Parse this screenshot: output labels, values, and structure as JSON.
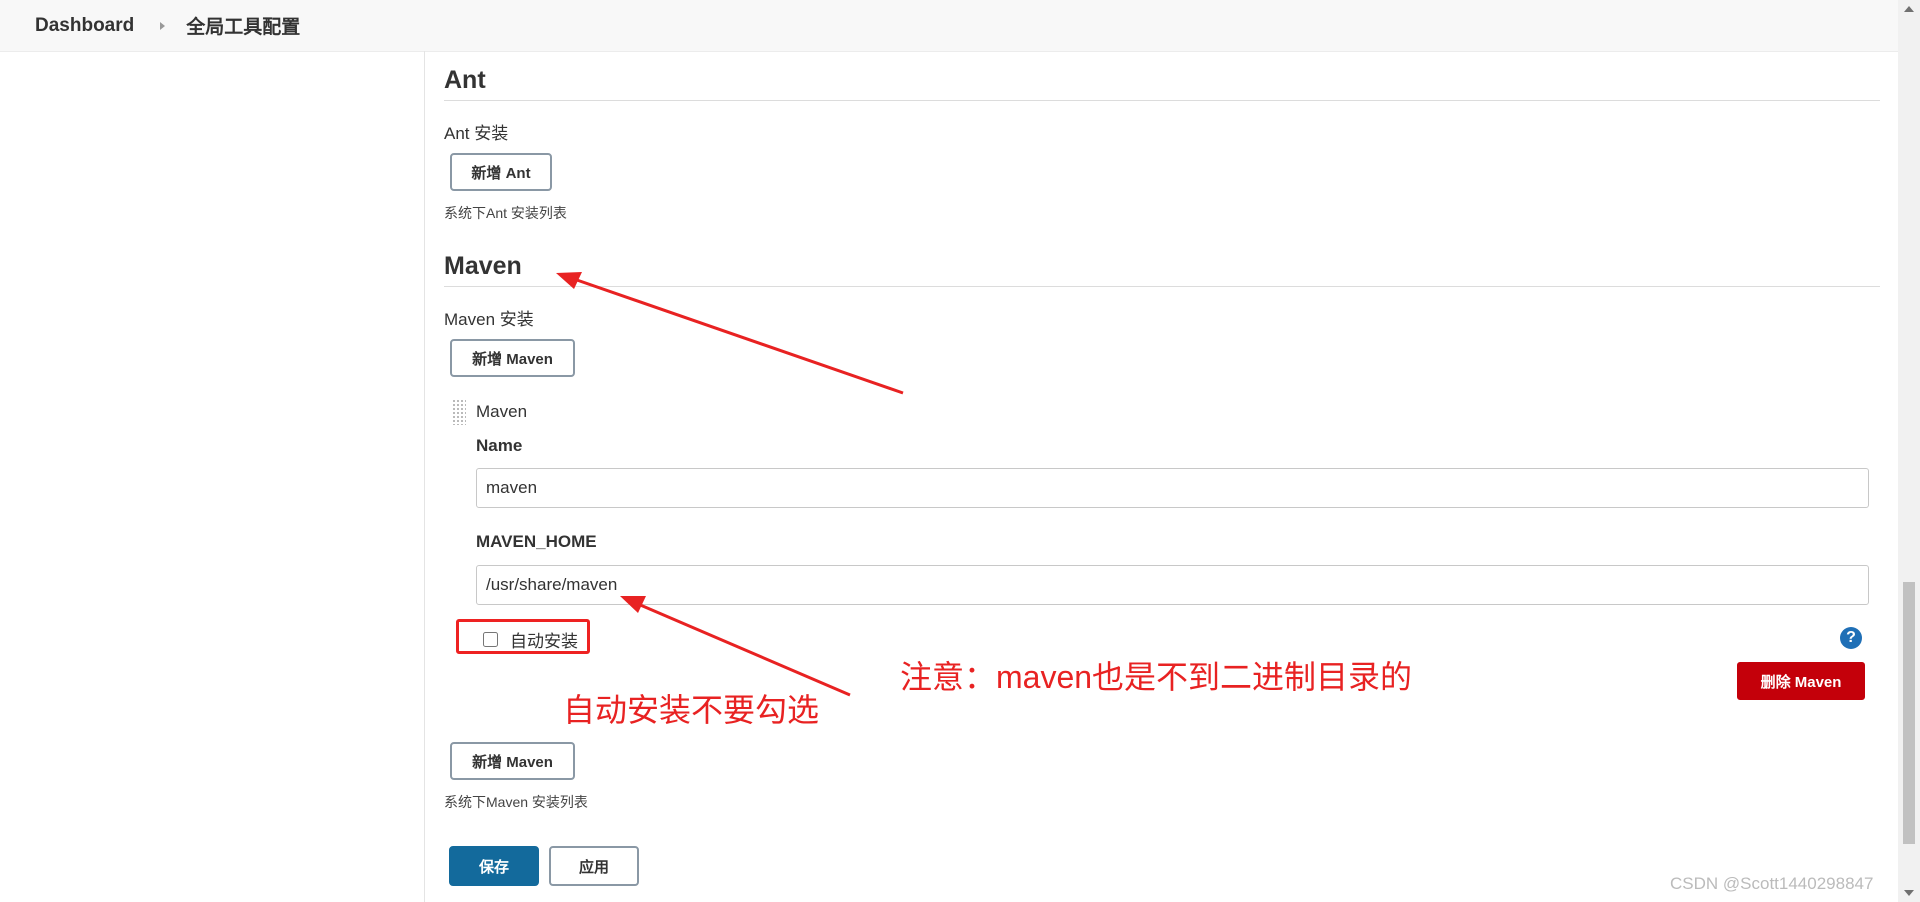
{
  "breadcrumb": {
    "home": "Dashboard",
    "current": "全局工具配置"
  },
  "ant": {
    "title": "Ant",
    "install_label": "Ant 安装",
    "add_button": "新增 Ant",
    "help_text": "系统下Ant 安装列表"
  },
  "maven": {
    "title": "Maven",
    "install_label": "Maven 安装",
    "add_button_top": "新增 Maven",
    "item_title": "Maven",
    "name_label": "Name",
    "name_value": "maven",
    "home_label": "MAVEN_HOME",
    "home_value": "/usr/share/maven",
    "auto_install_label": "自动安装",
    "help_icon": "?",
    "delete_button": "删除 Maven",
    "add_button_bottom": "新增 Maven",
    "help_text": "系统下Maven 安装列表"
  },
  "footer": {
    "save_button": "保存",
    "apply_button": "应用"
  },
  "annotations": {
    "note_main": "注意：maven也是不到二进制目录的",
    "note_checkbox": "自动安装不要勾选",
    "color": "#e82222"
  },
  "watermark": "CSDN @Scott1440298847"
}
